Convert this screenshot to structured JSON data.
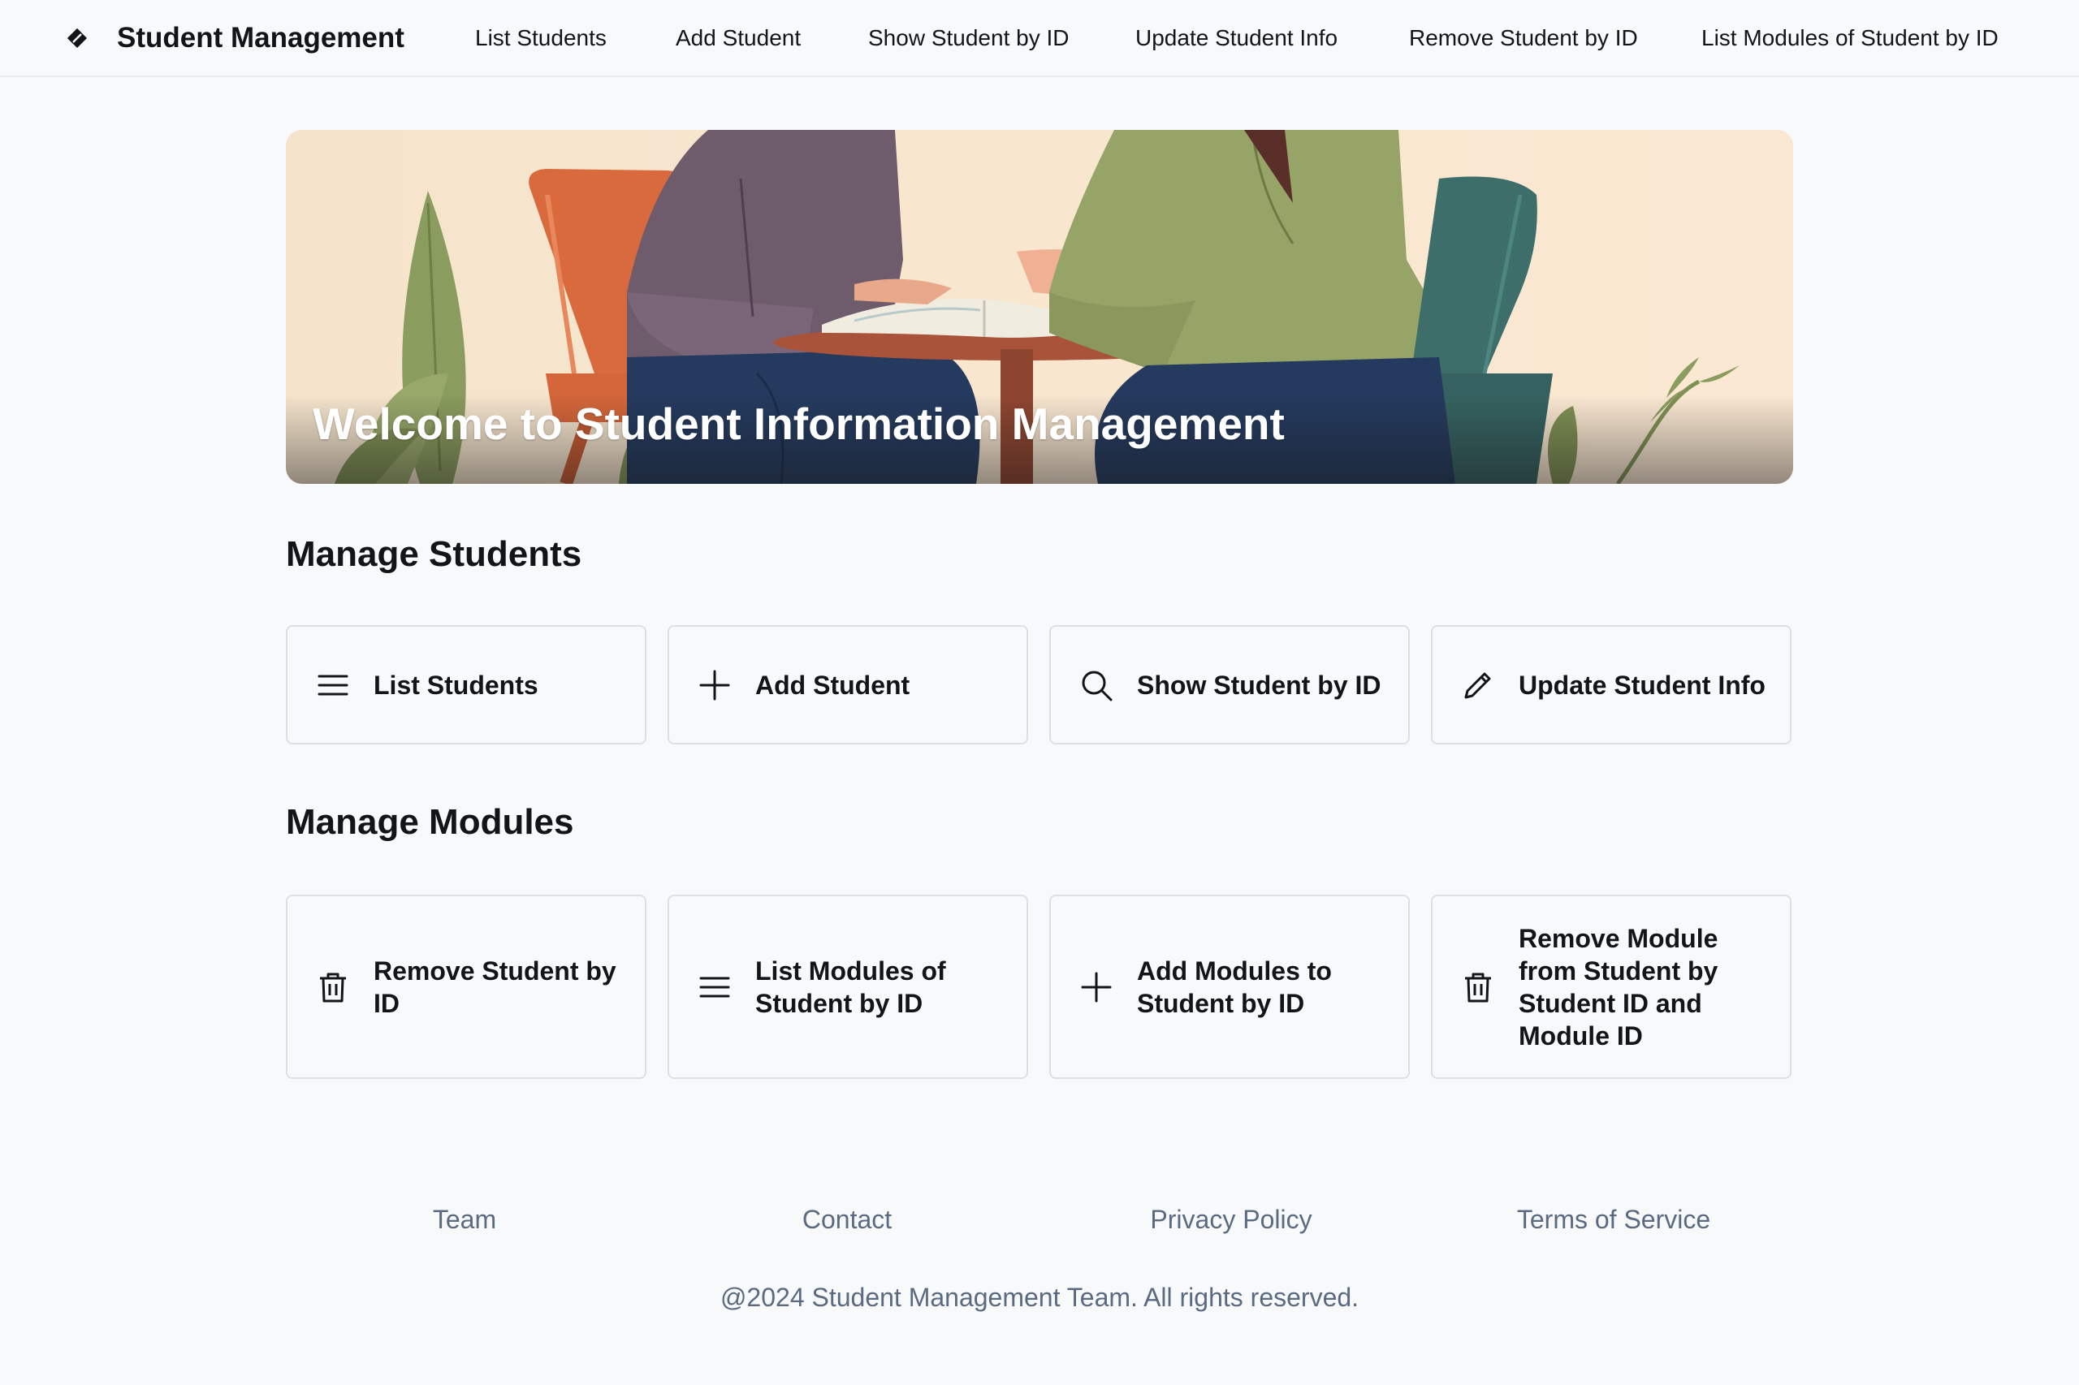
{
  "header": {
    "brand": "Student Management",
    "brand_icon": "brand-diamond-icon",
    "nav": [
      {
        "label": "List Students"
      },
      {
        "label": "Add Student"
      },
      {
        "label": "Show Student by ID"
      },
      {
        "label": "Update Student Info"
      },
      {
        "label": "Remove Student by ID"
      },
      {
        "label": "List Modules of Student by ID"
      }
    ]
  },
  "hero": {
    "title": "Welcome to Student Information Management"
  },
  "students_section": {
    "title": "Manage Students",
    "cards": [
      {
        "label": "List Students",
        "icon": "list-icon"
      },
      {
        "label": "Add Student",
        "icon": "plus-icon"
      },
      {
        "label": "Show Student by ID",
        "icon": "search-icon"
      },
      {
        "label": "Update Student Info",
        "icon": "pencil-icon"
      }
    ]
  },
  "modules_section": {
    "title": "Manage Modules",
    "cards": [
      {
        "label": "Remove Student by ID",
        "icon": "trash-icon"
      },
      {
        "label": "List Modules of Student by ID",
        "icon": "list-icon"
      },
      {
        "label": "Add Modules to Student by ID",
        "icon": "plus-icon"
      },
      {
        "label": "Remove Module from Student by Student ID and Module ID",
        "icon": "trash-icon"
      }
    ]
  },
  "footer": {
    "links": [
      {
        "label": "Team"
      },
      {
        "label": "Contact"
      },
      {
        "label": "Privacy Policy"
      },
      {
        "label": "Terms of Service"
      }
    ],
    "copyright": "@2024 Student Management Team. All rights reserved."
  },
  "colors": {
    "background": "#f8f9fb",
    "text": "#121416",
    "muted": "#5a6a80",
    "border": "#dcdfe4"
  }
}
